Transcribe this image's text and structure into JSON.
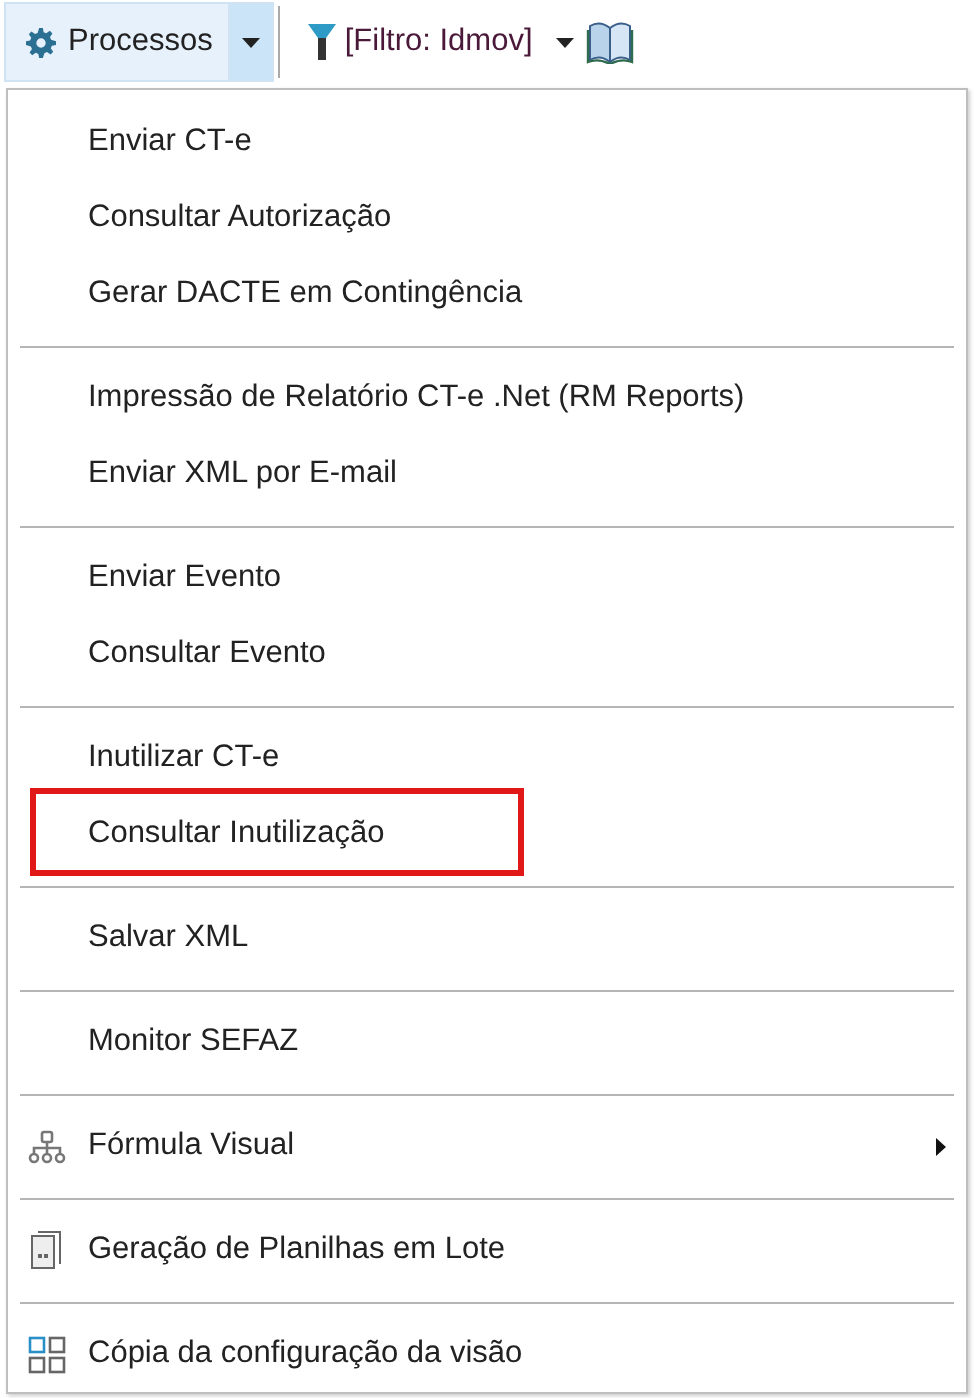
{
  "toolbar": {
    "process_button": {
      "label": "Processos",
      "dropdown_pressed": true
    },
    "filter": {
      "label": "[Filtro: Idmov]"
    }
  },
  "menu": {
    "groups": [
      [
        {
          "label": "Enviar CT-e",
          "kind": "plain",
          "submenu": false,
          "highlighted": false
        },
        {
          "label": "Consultar Autorização",
          "kind": "plain",
          "submenu": false,
          "highlighted": false
        },
        {
          "label": "Gerar DACTE em Contingência",
          "kind": "plain",
          "submenu": false,
          "highlighted": false
        }
      ],
      [
        {
          "label": "Impressão de Relatório CT-e .Net (RM Reports)",
          "kind": "plain",
          "submenu": false,
          "highlighted": false
        },
        {
          "label": "Enviar XML por E-mail",
          "kind": "plain",
          "submenu": false,
          "highlighted": false
        }
      ],
      [
        {
          "label": "Enviar Evento",
          "kind": "plain",
          "submenu": false,
          "highlighted": false
        },
        {
          "label": "Consultar Evento",
          "kind": "plain",
          "submenu": false,
          "highlighted": false
        }
      ],
      [
        {
          "label": "Inutilizar CT-e",
          "kind": "plain",
          "submenu": false,
          "highlighted": false
        },
        {
          "label": "Consultar Inutilização",
          "kind": "plain",
          "submenu": false,
          "highlighted": true
        }
      ],
      [
        {
          "label": "Salvar XML",
          "kind": "plain",
          "submenu": false,
          "highlighted": false
        }
      ],
      [
        {
          "label": "Monitor SEFAZ",
          "kind": "plain",
          "submenu": false,
          "highlighted": false
        }
      ],
      [
        {
          "label": "Fórmula Visual",
          "kind": "hierarchy",
          "submenu": true,
          "highlighted": false
        }
      ],
      [
        {
          "label": "Geração de Planilhas em Lote",
          "kind": "spreadsheet",
          "submenu": false,
          "highlighted": false
        }
      ],
      [
        {
          "label": "Cópia da configuração da visão",
          "kind": "grid",
          "submenu": false,
          "highlighted": false
        }
      ]
    ]
  }
}
